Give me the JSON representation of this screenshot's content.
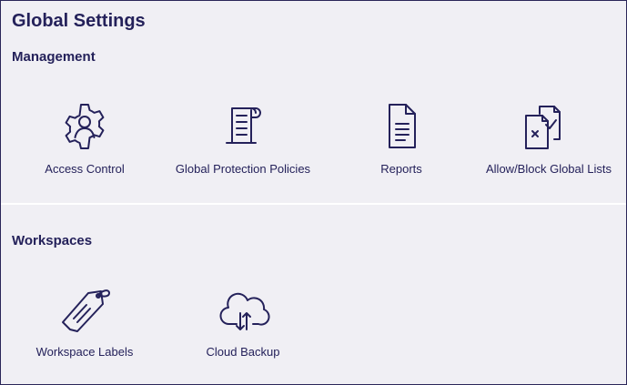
{
  "page": {
    "title": "Global Settings"
  },
  "sections": {
    "management": {
      "title": "Management",
      "items": [
        {
          "label": "Access Control",
          "icon": "gear-person-icon"
        },
        {
          "label": "Global Protection Policies",
          "icon": "scroll-document-icon"
        },
        {
          "label": "Reports",
          "icon": "document-icon"
        },
        {
          "label": "Allow/Block Global Lists",
          "icon": "allow-block-documents-icon"
        }
      ]
    },
    "workspaces": {
      "title": "Workspaces",
      "items": [
        {
          "label": "Workspace Labels",
          "icon": "tag-icon"
        },
        {
          "label": "Cloud Backup",
          "icon": "cloud-sync-icon"
        }
      ]
    }
  },
  "colors": {
    "text": "#24215a",
    "background": "#f0eff4",
    "divider": "#ffffff",
    "border": "#2a2658"
  }
}
